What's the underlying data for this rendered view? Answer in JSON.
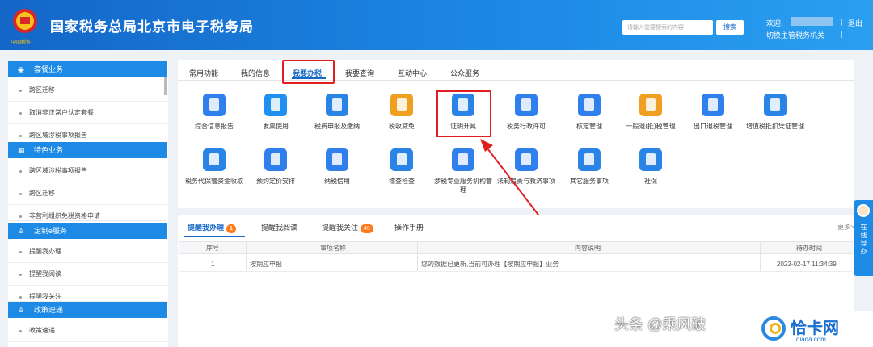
{
  "header": {
    "title": "国家税务总局北京市电子税务局",
    "emblem_text": "中国税务",
    "search_placeholder": "请输入需要搜索的内容",
    "search_button": "搜索",
    "welcome": "欢迎,",
    "separator": "|",
    "logout": "退出",
    "switch_authority": "切换主管税务机关"
  },
  "sidebar": {
    "sections": [
      {
        "title": "套餐业务",
        "icon": "package-icon"
      },
      {
        "title": "特色业务",
        "icon": "grid-icon"
      },
      {
        "title": "定制e服务",
        "icon": "user-icon"
      },
      {
        "title": "政策速递",
        "icon": "user-icon"
      }
    ],
    "items": [
      "跨区迁移",
      "取消非正常户认定套餐",
      "跨区域涉税事项报告",
      "跨区域涉税事项报告",
      "跨区迁移",
      "非营利组织免税资格申请",
      "提醒我办理",
      "提醒我阅读",
      "提醒我关注",
      "政策速递"
    ]
  },
  "tabs": [
    "常用功能",
    "我的信息",
    "我要办税",
    "我要查询",
    "互动中心",
    "公众服务"
  ],
  "services": [
    {
      "label": "综合信息报告",
      "color": "#2f80ed"
    },
    {
      "label": "发票使用",
      "color": "#1f8ff0"
    },
    {
      "label": "税费申报及缴纳",
      "color": "#2a84e6"
    },
    {
      "label": "税收减免",
      "color": "#f0a020"
    },
    {
      "label": "证明开具",
      "color": "#2a84e6"
    },
    {
      "label": "税务行政许可",
      "color": "#2f80ed"
    },
    {
      "label": "核定管理",
      "color": "#2f80ed"
    },
    {
      "label": "一般退(抵)税管理",
      "color": "#f0a020"
    },
    {
      "label": "出口退税管理",
      "color": "#2f80ed"
    },
    {
      "label": "增值税抵扣凭证管理",
      "color": "#2a84e6"
    },
    {
      "label": "税务代保管资金收取",
      "color": "#2a84e6"
    },
    {
      "label": "预约定价安排",
      "color": "#2f80ed"
    },
    {
      "label": "纳税信用",
      "color": "#2f80ed"
    },
    {
      "label": "稽查检查",
      "color": "#2a84e6"
    },
    {
      "label": "涉税专业服务机构管理",
      "color": "#2f80ed"
    },
    {
      "label": "法制追责与救济事项",
      "color": "#2f80ed"
    },
    {
      "label": "其它服务事项",
      "color": "#2a84e6"
    },
    {
      "label": "社保",
      "color": "#2a84e6"
    }
  ],
  "bottom_tabs": [
    {
      "label": "提醒我办理",
      "badge": "1"
    },
    {
      "label": "提醒我阅读",
      "badge": ""
    },
    {
      "label": "提醒我关注",
      "badge": "49"
    },
    {
      "label": "操作手册",
      "badge": ""
    }
  ],
  "more": "更多>",
  "table": {
    "headers": [
      "序号",
      "事项名称",
      "内容说明",
      "待办时间"
    ],
    "rows": [
      [
        "1",
        "按期应申报",
        "您的数据已更新,当前可办理【按期应申报】业务",
        "2022-02-17 11:34:39"
      ]
    ]
  },
  "float_guide": {
    "text": "在线导办"
  },
  "watermark": {
    "text": "头条 @乘风破",
    "logo_name": "恰卡网",
    "logo_url": "qiaqa.com"
  }
}
